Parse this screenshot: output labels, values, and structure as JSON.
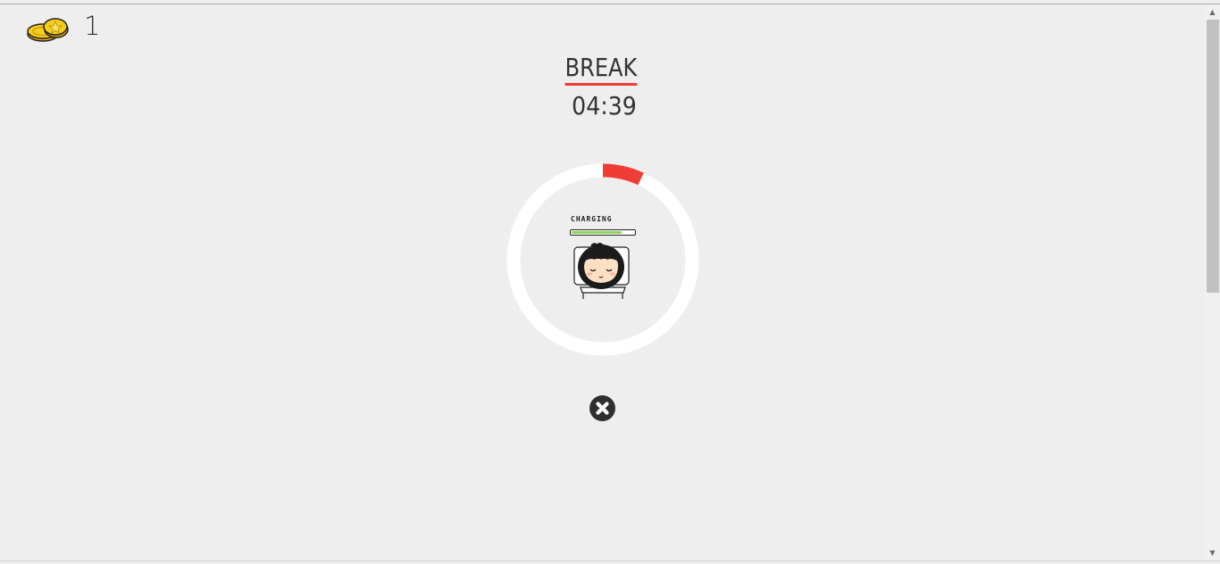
{
  "coins": {
    "icon": "coin-stack-icon",
    "count": "1"
  },
  "session": {
    "mode": "BREAK",
    "time_remaining": "04:39",
    "progress_fraction": 0.07,
    "colors": {
      "accent": "#f03c36",
      "ring_track": "#ffffff",
      "background": "#eeeeee"
    }
  },
  "character": {
    "status_label": "CHARGING",
    "charge_fraction": 0.8,
    "icon": "sleeping-character-icon"
  },
  "controls": {
    "stop_icon": "close-circle-icon"
  },
  "scrollbar": {
    "up_icon": "scroll-up-arrow-icon",
    "down_icon": "scroll-down-arrow-icon"
  }
}
